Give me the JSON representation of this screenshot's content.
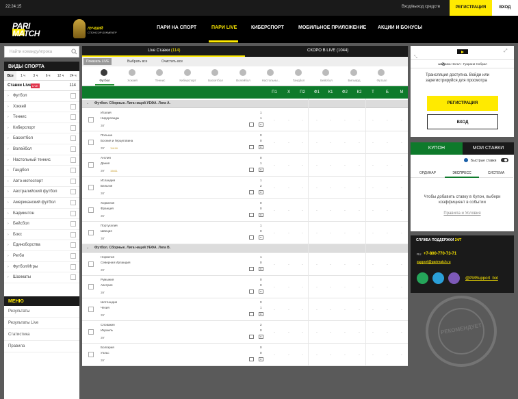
{
  "topbar": {
    "time": "22:24:15",
    "enter_label": "Вход/выход средств",
    "register": "РЕГИСТРАЦИЯ",
    "login": "ВХОД"
  },
  "logo": {
    "line1": "PARI",
    "line2": "MATCH"
  },
  "award": {
    "line1": "ЛУЧШИЙ",
    "line2": "СПОНСОР БУКМЕКЕР"
  },
  "nav": [
    "ПАРИ НА СПОРТ",
    "ПАРИ LIVE",
    "КИБЕРСПОРТ",
    "МОБИЛЬНОЕ ПРИЛОЖЕНИЕ",
    "АКЦИИ И БОНУСЫ"
  ],
  "search": {
    "placeholder": "Найти команду/игрока"
  },
  "sports": {
    "header": "ВИДЫ СПОРТА",
    "ranges": [
      "Все",
      "1 ч",
      "3 ч",
      "6 ч",
      "12 ч",
      "24 ч"
    ],
    "live_label": "Ставки Live",
    "live_badge": "LIVE",
    "live_count": "114",
    "items": [
      "Футбол",
      "Хоккей",
      "Теннис",
      "Киберспорт",
      "Баскетбол",
      "Волейбол",
      "Настольный теннис",
      "Гандбол",
      "Авто-мотоспорт",
      "Австралийский футбол",
      "Американский футбол",
      "Бадминтон",
      "Бейсбол",
      "Бокс",
      "Единоборства",
      "Регби",
      "Футбол/Игры",
      "Шахматы"
    ]
  },
  "menu": {
    "header": "МЕНЮ",
    "items": [
      "Результаты",
      "Результаты Live",
      "Статистика",
      "Правила"
    ]
  },
  "center": {
    "tab_live": "Live Ставки",
    "tab_live_count": "(114)",
    "tab_soon": "СКОРО В LIVE",
    "tab_soon_count": "(1044)",
    "sub": [
      "Показать LIVE",
      "Выбрать все",
      "Очистить все"
    ],
    "sporttabs": [
      "Футбол",
      "Хоккей",
      "Теннис",
      "Киберспорт",
      "Баскетбол",
      "Волейбол",
      "Настольны...",
      "Гандбол",
      "Бейсбол",
      "Бильярд",
      "Футзал"
    ],
    "columns": [
      "П1",
      "Х",
      "П2",
      "Ф1",
      "К1",
      "Ф2",
      "К2",
      "Т",
      "Б",
      "М"
    ],
    "leagues": [
      "Футбол. Сборные. Лига наций УЕФА. Лига A.",
      "Футбол. Сборные. Лига наций УЕФА. Лига B."
    ],
    "matches": [
      {
        "t1": "Италия",
        "t2": "Нидерланды",
        "min": "38'",
        "s1": "1",
        "s2": "1",
        "extra": ""
      },
      {
        "t1": "Польша",
        "t2": "Босния и Герцеговина",
        "min": "39'",
        "s1": "0",
        "s2": "0",
        "extra": "11618"
      },
      {
        "t1": "Англия",
        "t2": "Дания",
        "min": "39'",
        "s1": "0",
        "s2": "1",
        "extra": "15811"
      },
      {
        "t1": "Исландия",
        "t2": "Бельгия",
        "min": "38'",
        "s1": "1",
        "s2": "2",
        "extra": ""
      },
      {
        "t1": "Хорватия",
        "t2": "Франция",
        "min": "35'",
        "s1": "0",
        "s2": "0",
        "extra": ""
      },
      {
        "t1": "Португалия",
        "t2": "Швеция",
        "min": "38'",
        "s1": "1",
        "s2": "0",
        "extra": ""
      },
      {
        "t1": "Норвегия",
        "t2": "Северная Ирландия",
        "min": "39'",
        "s1": "1",
        "s2": "0",
        "extra": ""
      },
      {
        "t1": "Румыния",
        "t2": "Австрия",
        "min": "39'",
        "s1": "0",
        "s2": "0",
        "extra": ""
      },
      {
        "t1": "Шотландия",
        "t2": "Чехия",
        "min": "39'",
        "s1": "0",
        "s2": "1",
        "extra": ""
      },
      {
        "t1": "Словакия",
        "t2": "Израиль",
        "min": "39'",
        "s1": "2",
        "s2": "0",
        "extra": ""
      },
      {
        "t1": "Болгария",
        "t2": "Уэльс",
        "min": "39'",
        "s1": "0",
        "s2": "0",
        "extra": ""
      }
    ]
  },
  "video": {
    "match": "Америка Натал - Гуарани Собрал",
    "message": "Трансляция доступна. Войди или зарегистрируйся для просмотра",
    "register": "РЕГИСТРАЦИЯ",
    "login": "ВХОД"
  },
  "coupon": {
    "tab1": "КУПОН",
    "tab2": "МОИ СТАВКИ",
    "fast": "Быстрые ставки",
    "types": [
      "ОРДИНАР",
      "ЭКСПРЕСС",
      "СИСТЕМА"
    ],
    "text": "Чтобы добавить ставку в Купон, выбери коэффициент в событии",
    "rules": "Правила и Условия"
  },
  "support": {
    "title": "СЛУЖБА ПОДДЕРЖКИ",
    "title_hl": "24/7",
    "country": "RU",
    "phone": "+7-800-770-73-71",
    "email": "support@parimatch.ru",
    "bot": "@PMSupport_bot"
  },
  "stamp": {
    "text": "РЕКОМЕНДУЕТ"
  },
  "colors": {
    "accent": "#ffea00",
    "green": "#0e7a2b",
    "dark": "#1a1a1a"
  }
}
